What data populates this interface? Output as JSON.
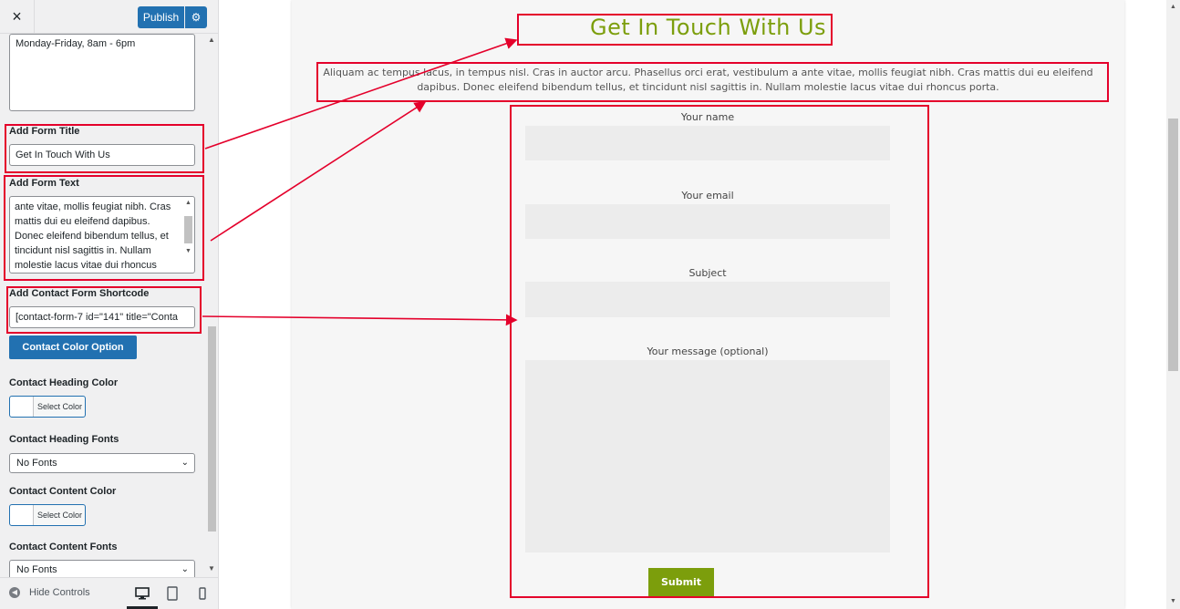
{
  "topbar": {
    "close_icon": "×",
    "publish_label": "Publish",
    "gear_icon": "⚙"
  },
  "sidebar": {
    "hours_value": "Monday-Friday, 8am - 6pm",
    "form_title_label": "Add Form Title",
    "form_title_value": "Get In Touch With Us",
    "form_text_label": "Add Form Text",
    "form_text_value": "ante vitae, mollis feugiat nibh. Cras mattis dui eu eleifend dapibus. Donec eleifend bibendum tellus, et tincidunt nisl sagittis in. Nullam molestie lacus vitae dui rhoncus",
    "shortcode_label": "Add Contact Form Shortcode",
    "shortcode_value": "[contact-form-7 id=\"141\" title=\"Conta",
    "color_option_button": "Contact Color Option",
    "heading_color_label": "Contact Heading Color",
    "select_color_label": "Select Color",
    "heading_fonts_label": "Contact Heading Fonts",
    "heading_fonts_value": "No Fonts",
    "content_color_label": "Contact Content Color",
    "content_fonts_label": "Contact Content Fonts",
    "content_fonts_value": "No Fonts"
  },
  "footer": {
    "hide_controls_label": "Hide Controls"
  },
  "preview": {
    "heading": "Get In Touch With Us",
    "text": "Aliquam ac tempus lacus, in tempus nisl. Cras in auctor arcu. Phasellus orci erat, vestibulum a ante vitae, mollis feugiat nibh. Cras mattis dui eu eleifend dapibus. Donec eleifend bibendum tellus, et tincidunt nisl sagittis in. Nullam molestie lacus vitae dui rhoncus porta.",
    "field_name_label": "Your name",
    "field_email_label": "Your email",
    "field_subject_label": "Subject",
    "field_message_label": "Your message (optional)",
    "submit_label": "Submit"
  },
  "colors": {
    "accent": "#7c9e0c",
    "wp_blue": "#2271b1",
    "annotation_red": "#e4002b"
  }
}
